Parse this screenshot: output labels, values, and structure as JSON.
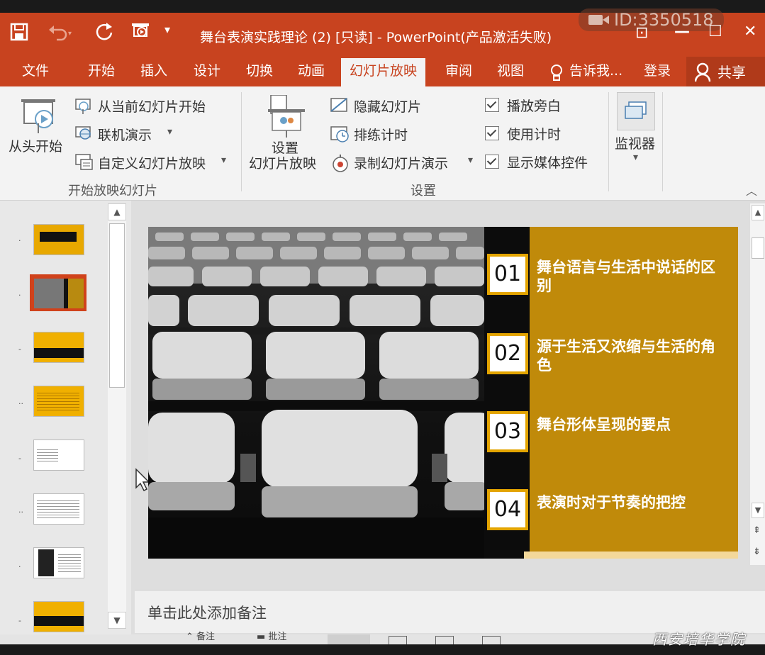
{
  "window": {
    "title": "舞台表演实践理论 (2) [只读] - PowerPoint(产品激活失败)",
    "watermark_id": "ID:3350518",
    "controls": {
      "restore_ribbon": "⊡",
      "minimize": "—",
      "maximize": "☐",
      "close": "✕"
    }
  },
  "tabs": [
    {
      "label": "文件"
    },
    {
      "label": "开始"
    },
    {
      "label": "插入"
    },
    {
      "label": "设计"
    },
    {
      "label": "切换"
    },
    {
      "label": "动画"
    },
    {
      "label": "幻灯片放映",
      "active": true
    },
    {
      "label": "审阅"
    },
    {
      "label": "视图"
    },
    {
      "label": "告诉我..."
    },
    {
      "label": "登录"
    },
    {
      "label": "共享"
    }
  ],
  "ribbon": {
    "start_group": {
      "from_beginning": "从头开始",
      "from_current": "从当前幻灯片开始",
      "online_present": "联机演示",
      "custom_show": "自定义幻灯片放映",
      "label": "开始放映幻灯片"
    },
    "setup_group": {
      "setup_show_line1": "设置",
      "setup_show_line2": "幻灯片放映",
      "hide_slide": "隐藏幻灯片",
      "rehearse": "排练计时",
      "record": "录制幻灯片演示",
      "play_narrations": "播放旁白",
      "use_timings": "使用计时",
      "show_media_controls": "显示媒体控件",
      "label": "设置"
    },
    "monitor_group": {
      "monitor": "监视器"
    }
  },
  "thumbnails": [
    {
      "num": "·",
      "selected": false
    },
    {
      "num": "·",
      "selected": true
    },
    {
      "num": "-",
      "selected": false
    },
    {
      "num": "··",
      "selected": false
    },
    {
      "num": "-",
      "selected": false
    },
    {
      "num": "··",
      "selected": false
    },
    {
      "num": "·",
      "selected": false
    },
    {
      "num": "-",
      "selected": false
    }
  ],
  "slide": {
    "items": [
      {
        "num": "01",
        "text": "舞台语言与生活中说话的区别"
      },
      {
        "num": "02",
        "text": "源于生活又浓缩与生活的角色"
      },
      {
        "num": "03",
        "text": "舞台形体呈现的要点"
      },
      {
        "num": "04",
        "text": "表演时对于节奏的把控"
      }
    ],
    "colors": {
      "panel": "#c08a0a",
      "number_border": "#e3a400"
    }
  },
  "notes": {
    "placeholder": "单击此处添加备注"
  },
  "status": {
    "notes": "备注",
    "comments": "批注"
  },
  "watermark": "西安培华学院"
}
